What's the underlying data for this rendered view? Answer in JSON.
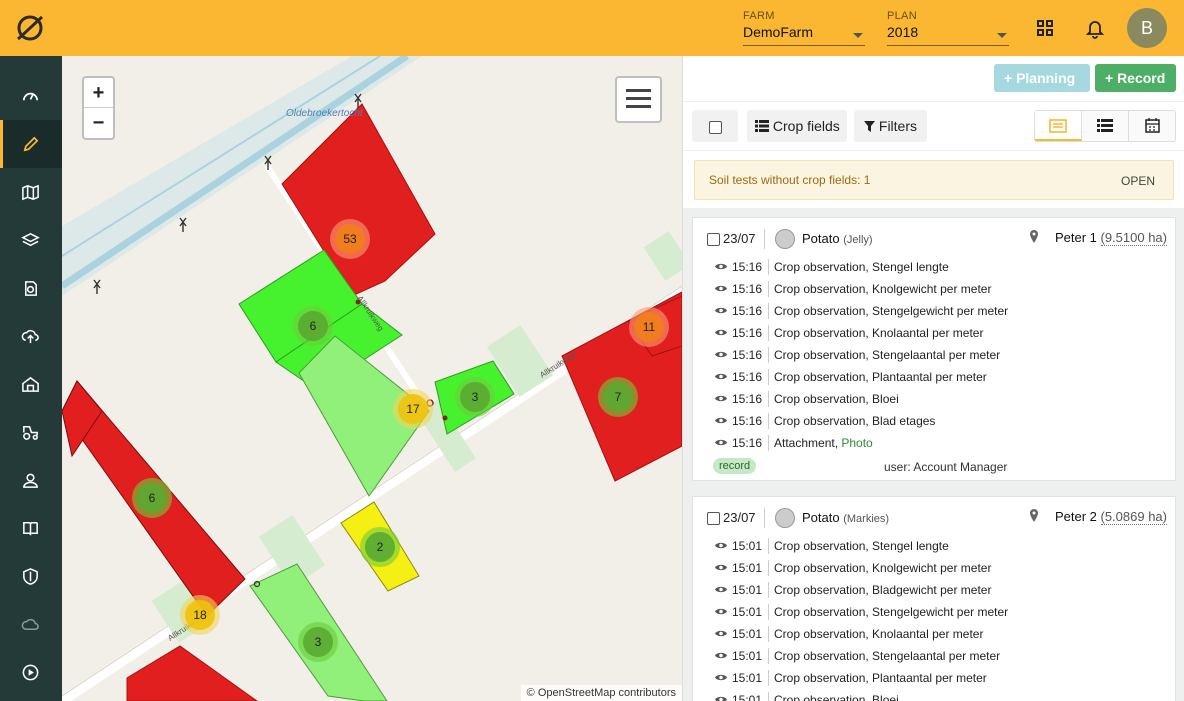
{
  "header": {
    "farm_label": "FARM",
    "farm_value": "DemoFarm",
    "plan_label": "PLAN",
    "plan_value": "2018",
    "avatar_initial": "B",
    "brand_color": "#fbb731"
  },
  "sidebar": {
    "items": [
      {
        "name": "dashboard-icon"
      },
      {
        "name": "pencil-icon",
        "active": true
      },
      {
        "name": "map-icon"
      },
      {
        "name": "layers-icon"
      },
      {
        "name": "soil-sample-icon"
      },
      {
        "name": "cloud-upload-icon"
      },
      {
        "name": "barn-icon"
      },
      {
        "name": "tractor-icon"
      },
      {
        "name": "user-icon"
      },
      {
        "name": "book-icon"
      },
      {
        "name": "shield-icon"
      },
      {
        "name": "weather-icon"
      },
      {
        "name": "play-icon"
      }
    ]
  },
  "map": {
    "zoom_in": "+",
    "zoom_out": "−",
    "attribution": "© OpenStreetMap contributors",
    "labels": {
      "canal": "Oldebroekertocht",
      "road1": "Allkruikweg",
      "road2": "Allkruikweg",
      "road3": "Allkruikweg"
    },
    "clusters": [
      {
        "count": "53",
        "color": "orange"
      },
      {
        "count": "6",
        "color": "green"
      },
      {
        "count": "17",
        "color": "yellow"
      },
      {
        "count": "3",
        "color": "green"
      },
      {
        "count": "11",
        "color": "orange"
      },
      {
        "count": "7",
        "color": "green"
      },
      {
        "count": "6",
        "color": "green"
      },
      {
        "count": "2",
        "color": "green"
      },
      {
        "count": "18",
        "color": "yellow"
      },
      {
        "count": "3",
        "color": "green"
      }
    ]
  },
  "panel": {
    "planning_label": "+ Planning",
    "record_label": "+ Record",
    "crop_fields_label": "Crop fields",
    "filters_label": "Filters",
    "alert_text": "Soil tests without crop fields: 1",
    "alert_action": "OPEN",
    "cards": [
      {
        "date": "23/07",
        "crop": "Potato",
        "variety": "(Jelly)",
        "field": "Peter 1",
        "area": "(9.5100 ha)",
        "rows": [
          {
            "time": "15:16",
            "desc": "Crop observation, Stengel lengte"
          },
          {
            "time": "15:16",
            "desc": "Crop observation, Knolgewicht per meter"
          },
          {
            "time": "15:16",
            "desc": "Crop observation, Stengelgewicht per meter"
          },
          {
            "time": "15:16",
            "desc": "Crop observation, Knolaantal per meter"
          },
          {
            "time": "15:16",
            "desc": "Crop observation, Stengelaantal per meter"
          },
          {
            "time": "15:16",
            "desc": "Crop observation, Plantaantal per meter"
          },
          {
            "time": "15:16",
            "desc": "Crop observation, Bloei"
          },
          {
            "time": "15:16",
            "desc": "Crop observation, Blad etages"
          },
          {
            "time": "15:16",
            "desc": "Attachment, ",
            "link": "Photo"
          }
        ],
        "badge": "record",
        "user": "user: Account Manager"
      },
      {
        "date": "23/07",
        "crop": "Potato",
        "variety": "(Markies)",
        "field": "Peter 2",
        "area": "(5.0869 ha)",
        "rows": [
          {
            "time": "15:01",
            "desc": "Crop observation, Stengel lengte"
          },
          {
            "time": "15:01",
            "desc": "Crop observation, Knolgewicht per meter"
          },
          {
            "time": "15:01",
            "desc": "Crop observation, Bladgewicht per meter"
          },
          {
            "time": "15:01",
            "desc": "Crop observation, Stengelgewicht per meter"
          },
          {
            "time": "15:01",
            "desc": "Crop observation, Knolaantal per meter"
          },
          {
            "time": "15:01",
            "desc": "Crop observation, Stengelaantal per meter"
          },
          {
            "time": "15:01",
            "desc": "Crop observation, Plantaantal per meter"
          },
          {
            "time": "15:01",
            "desc": "Crop observation, Bloei"
          }
        ]
      }
    ]
  }
}
